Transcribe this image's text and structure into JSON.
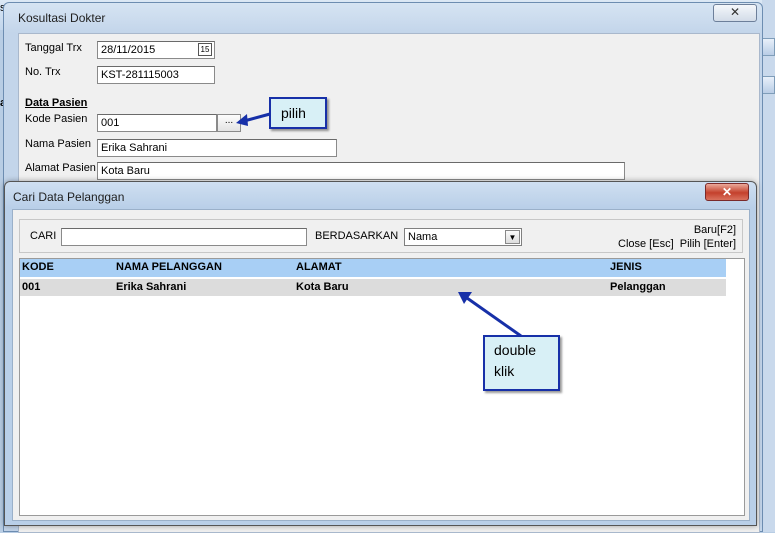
{
  "background": {
    "menu_fragments": [
      "st",
      "ar"
    ]
  },
  "konsultasi": {
    "title": "Kosultasi Dokter",
    "close_label": "✕",
    "tanggal_label": "Tanggal Trx",
    "tanggal_value": "28/11/2015",
    "calendar_glyph": "15",
    "no_trx_label": "No. Trx",
    "no_trx_value": "KST-281115003",
    "section_title": "Data Pasien",
    "kode_label": "Kode Pasien",
    "kode_value": "001",
    "browse_label": "...",
    "nama_label": "Nama Pasien",
    "nama_value": "Erika Sahrani",
    "alamat_label": "Alamat Pasien",
    "alamat_value": "Kota Baru"
  },
  "callouts": {
    "pilih": "pilih",
    "double_klik_line1": "double",
    "double_klik_line2": "klik"
  },
  "dialog": {
    "title": "Cari Data Pelanggan",
    "close_label": "✕",
    "cari_label": "CARI",
    "cari_value": "",
    "berdasarkan_label": "BERDASARKAN",
    "berdasarkan_value": "Nama",
    "shortcut_baru": "Baru[F2]",
    "shortcut_close": "Close [Esc]",
    "shortcut_pilih": "Pilih [Enter]",
    "columns": [
      "KODE",
      "NAMA PELANGGAN",
      "ALAMAT",
      "JENIS"
    ],
    "rows": [
      {
        "kode": "001",
        "nama": "Erika Sahrani",
        "alamat": "Kota Baru",
        "jenis": "Pelanggan"
      }
    ]
  },
  "colors": {
    "accent_arrow": "#1730a8",
    "header_row": "#a8cff5",
    "selected_row": "#dcdcdc",
    "dialog_close": "#c4402c"
  }
}
